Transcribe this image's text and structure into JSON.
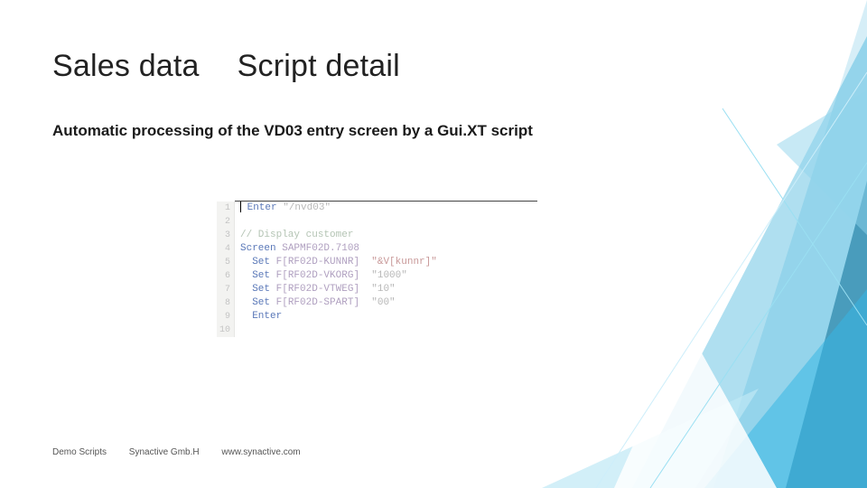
{
  "title_left": "Sales data",
  "title_right": "Script detail",
  "subtitle": "Automatic processing of the VD03 entry screen by a Gui.XT script",
  "code": {
    "lines": [
      {
        "n": "1",
        "html": "<span class='cursor'></span> <span class='kw-blue'>Enter</span> <span class='kw-gray'>\"/nvd03\"</span>"
      },
      {
        "n": "2",
        "html": ""
      },
      {
        "n": "3",
        "html": "<span class='kw-green'>// Display customer</span>"
      },
      {
        "n": "4",
        "html": "<span class='kw-blue'>Screen</span> <span class='kw-purple'>SAPMF02D.7108</span>"
      },
      {
        "n": "5",
        "html": "  <span class='kw-blue'>Set</span> <span class='kw-purple'>F[RF02D-KUNNR]</span>  <span class='kw-red'>\"&V[kunnr]\"</span>"
      },
      {
        "n": "6",
        "html": "  <span class='kw-blue'>Set</span> <span class='kw-purple'>F[RF02D-VKORG]</span>  <span class='kw-gray'>\"1000\"</span>"
      },
      {
        "n": "7",
        "html": "  <span class='kw-blue'>Set</span> <span class='kw-purple'>F[RF02D-VTWEG]</span>  <span class='kw-gray'>\"10\"</span>"
      },
      {
        "n": "8",
        "html": "  <span class='kw-blue'>Set</span> <span class='kw-purple'>F[RF02D-SPART]</span>  <span class='kw-gray'>\"00\"</span>"
      },
      {
        "n": "9",
        "html": "  <span class='kw-blue'>Enter</span>"
      },
      {
        "n": "10",
        "html": ""
      }
    ]
  },
  "footer": {
    "a": "Demo Scripts",
    "b": "Synactive Gmb.H",
    "c": "www.synactive.com"
  }
}
